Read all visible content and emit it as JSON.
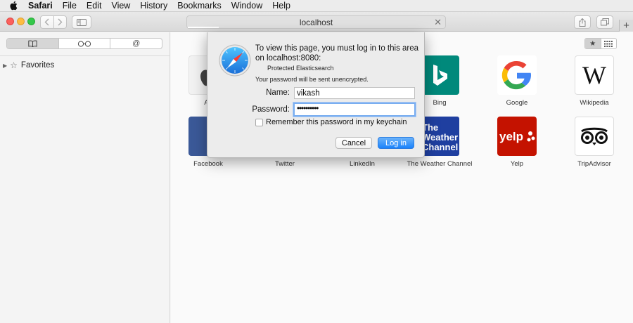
{
  "menubar": {
    "apple_icon": "apple-icon",
    "items": [
      "Safari",
      "File",
      "Edit",
      "View",
      "History",
      "Bookmarks",
      "Window",
      "Help"
    ]
  },
  "toolbar": {
    "url": "localhost",
    "back_icon": "chevron-left-icon",
    "forward_icon": "chevron-right-icon",
    "sidebar_icon": "sidebar-icon",
    "share_icon": "share-icon",
    "tabs_icon": "tabs-icon",
    "close_icon": "close-icon",
    "new_tab_symbol": "+"
  },
  "sidebar": {
    "segments": [
      "bookmarks-icon",
      "reading-list-icon",
      "shared-links-icon"
    ],
    "favorites_label": "Favorites"
  },
  "content": {
    "view_toggle": [
      "★",
      "grid-icon"
    ],
    "favorites": [
      {
        "label": "Apple",
        "visible_label": "Ap",
        "color": "#f0f0f0"
      },
      {
        "label": "Bing",
        "color": "#00897b"
      },
      {
        "label": "Google",
        "color": "#ffffff"
      },
      {
        "label": "Wikipedia",
        "color": "#ffffff"
      },
      {
        "label": "Facebook",
        "color": "#3b5998"
      },
      {
        "label": "Twitter",
        "color": "#ffffff"
      },
      {
        "label": "LinkedIn",
        "color": "#ffffff"
      },
      {
        "label": "The Weather Channel",
        "color": "#1f3fa0"
      },
      {
        "label": "Yelp",
        "color": "#c41200"
      },
      {
        "label": "TripAdvisor",
        "color": "#ffffff"
      }
    ]
  },
  "dialog": {
    "message": "To view this page, you must log in to this area on localhost:8080:",
    "realm": "Protected Elasticsearch",
    "warning": "Your password will be sent unencrypted.",
    "name_label": "Name:",
    "name_value": "vikash",
    "password_label": "Password:",
    "password_value": "••••••••••",
    "remember_label": "Remember this password in my keychain",
    "cancel_label": "Cancel",
    "login_label": "Log in"
  },
  "colors": {
    "accent": "#1a82fb",
    "traffic_red": "#fc605c",
    "traffic_yellow": "#fdbc40",
    "traffic_green": "#34c84a"
  }
}
